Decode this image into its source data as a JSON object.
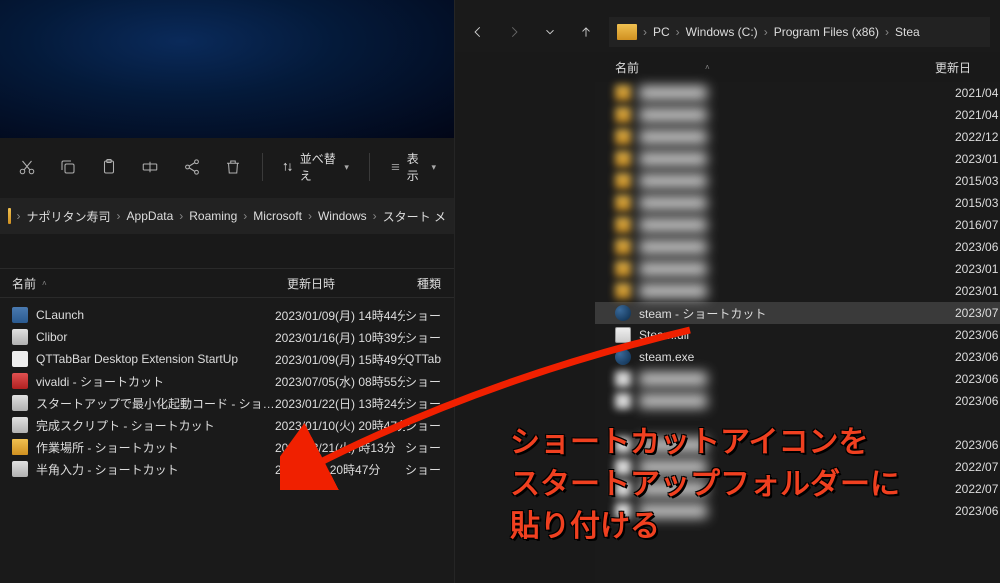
{
  "left": {
    "toolbar": {
      "sort_label": "並べ替え",
      "view_label": "表示"
    },
    "breadcrumb": [
      "ナポリタン寿司",
      "AppData",
      "Roaming",
      "Microsoft",
      "Windows",
      "スタート メ"
    ],
    "columns": {
      "name": "名前",
      "date": "更新日時",
      "type": "種類"
    },
    "files": [
      {
        "name": "CLaunch",
        "date": "2023/01/09(月) 14時44分",
        "type": "ショートカッ",
        "ico": "ico-app"
      },
      {
        "name": "Clibor",
        "date": "2023/01/16(月) 10時39分",
        "type": "ショートカッ",
        "ico": "ico-generic"
      },
      {
        "name": "QTTabBar Desktop Extension StartUp",
        "date": "2023/01/09(月) 15時49分",
        "type": "QTTabBa",
        "ico": "ico-white"
      },
      {
        "name": "vivaldi - ショートカット",
        "date": "2023/07/05(水) 08時55分",
        "type": "ショートカッ",
        "ico": "ico-red"
      },
      {
        "name": "スタートアップで最小化起動コード - ショートカット",
        "date": "2023/01/22(日) 13時24分",
        "type": "ショートカッ",
        "ico": "ico-generic"
      },
      {
        "name": "完成スクリプト - ショートカット",
        "date": "2023/01/10(火) 20時47分",
        "type": "ショートカッ",
        "ico": "ico-generic"
      },
      {
        "name": "作業場所 - ショートカット",
        "date": "2023/03/21(火)  時13分",
        "type": "ショートカッ",
        "ico": "ico-folder"
      },
      {
        "name": "半角入力 - ショートカット",
        "date": "2023/  /  (  ) 20時47分",
        "type": "ショートカッ",
        "ico": "ico-generic"
      }
    ]
  },
  "right": {
    "breadcrumb": [
      "PC",
      "Windows (C:)",
      "Program Files (x86)",
      "Stea"
    ],
    "columns": {
      "name": "名前",
      "date": "更新日"
    },
    "rows": [
      {
        "name": "████████",
        "date": "2021/04",
        "blur": true,
        "ico": "ico-folder"
      },
      {
        "name": "████████",
        "date": "2021/04",
        "blur": true,
        "ico": "ico-folder"
      },
      {
        "name": "████████",
        "date": "2022/12",
        "blur": true,
        "ico": "ico-folder"
      },
      {
        "name": "████████",
        "date": "2023/01",
        "blur": true,
        "ico": "ico-folder"
      },
      {
        "name": "████████",
        "date": "2015/03",
        "blur": true,
        "ico": "ico-folder"
      },
      {
        "name": "████████",
        "date": "2015/03",
        "blur": true,
        "ico": "ico-folder"
      },
      {
        "name": "████████",
        "date": "2016/07",
        "blur": true,
        "ico": "ico-folder"
      },
      {
        "name": "████████",
        "date": "2023/06",
        "blur": true,
        "ico": "ico-folder"
      },
      {
        "name": "████████",
        "date": "2023/01",
        "blur": true,
        "ico": "ico-folder"
      },
      {
        "name": "████████",
        "date": "2023/01",
        "blur": true,
        "ico": "ico-folder"
      },
      {
        "name": "steam - ショートカット",
        "date": "2023/07",
        "blur": false,
        "ico": "ico-steam",
        "selected": true
      },
      {
        "name": "Steam.dll",
        "date": "2023/06",
        "blur": false,
        "ico": "ico-dll"
      },
      {
        "name": "steam.exe",
        "date": "2023/06",
        "blur": false,
        "ico": "ico-steam"
      },
      {
        "name": "████████",
        "date": "2023/06",
        "blur": true,
        "ico": "ico-white"
      },
      {
        "name": "████████",
        "date": "2023/06",
        "blur": true,
        "ico": "ico-white"
      },
      {
        "name": "",
        "date": "",
        "blur": false,
        "ico": "",
        "empty": true
      },
      {
        "name": "████████",
        "date": "2023/06",
        "blur": true,
        "ico": "ico-white"
      },
      {
        "name": "████████",
        "date": "2022/07",
        "blur": true,
        "ico": "ico-white"
      },
      {
        "name": "████████",
        "date": "2022/07",
        "blur": true,
        "ico": "ico-white"
      },
      {
        "name": "████████",
        "date": "2023/06",
        "blur": true,
        "ico": "ico-white"
      }
    ]
  },
  "annotation": {
    "line1": "ショートカットアイコンを",
    "line2": "スタートアップフォルダーに",
    "line3": "貼り付ける"
  }
}
